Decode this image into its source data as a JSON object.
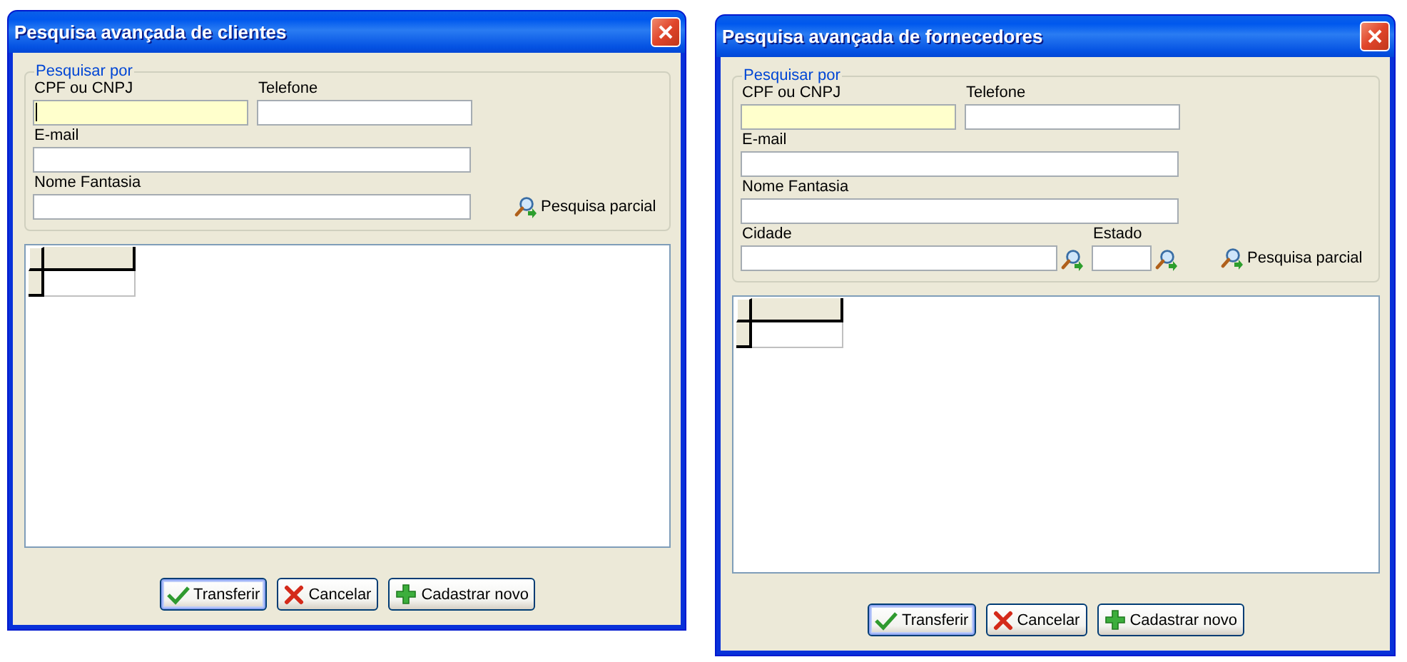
{
  "dialogs": [
    {
      "title": "Pesquisa avançada de clientes",
      "group": {
        "legend": "Pesquisar por",
        "rows": [
          [
            {
              "label": "CPF ou CNPJ",
              "kind": "text",
              "highlighted": true,
              "caret": true
            },
            {
              "label": "Telefone",
              "kind": "text",
              "highlighted": false,
              "caret": false
            }
          ],
          [
            {
              "label": "E-mail",
              "kind": "wide",
              "highlighted": false,
              "caret": false
            }
          ],
          [
            {
              "label": "Nome Fantasia",
              "kind": "wide",
              "highlighted": false,
              "caret": false
            }
          ]
        ],
        "partial_search": "Pesquisa parcial"
      },
      "buttons": [
        {
          "label": "Transferir",
          "kind": "confirm",
          "default": true
        },
        {
          "label": "Cancelar",
          "kind": "cancel",
          "default": false
        },
        {
          "label": "Cadastrar novo",
          "kind": "add",
          "default": false
        }
      ]
    },
    {
      "title": "Pesquisa avançada de fornecedores",
      "group": {
        "legend": "Pesquisar por",
        "rows": [
          [
            {
              "label": "CPF ou CNPJ",
              "kind": "text",
              "highlighted": true,
              "caret": false
            },
            {
              "label": "Telefone",
              "kind": "text",
              "highlighted": false,
              "caret": false
            }
          ],
          [
            {
              "label": "E-mail",
              "kind": "wide",
              "highlighted": false,
              "caret": false
            }
          ],
          [
            {
              "label": "Nome Fantasia",
              "kind": "wide",
              "highlighted": false,
              "caret": false
            }
          ],
          [
            {
              "label": "Cidade",
              "kind": "lookup",
              "highlighted": false,
              "caret": false
            },
            {
              "label": "Estado",
              "kind": "lookup-small",
              "highlighted": false,
              "caret": false
            }
          ]
        ],
        "partial_search": "Pesquisa parcial"
      },
      "buttons": [
        {
          "label": "Transferir",
          "kind": "confirm",
          "default": true
        },
        {
          "label": "Cancelar",
          "kind": "cancel",
          "default": false
        },
        {
          "label": "Cadastrar novo",
          "kind": "add",
          "default": false
        }
      ]
    }
  ]
}
